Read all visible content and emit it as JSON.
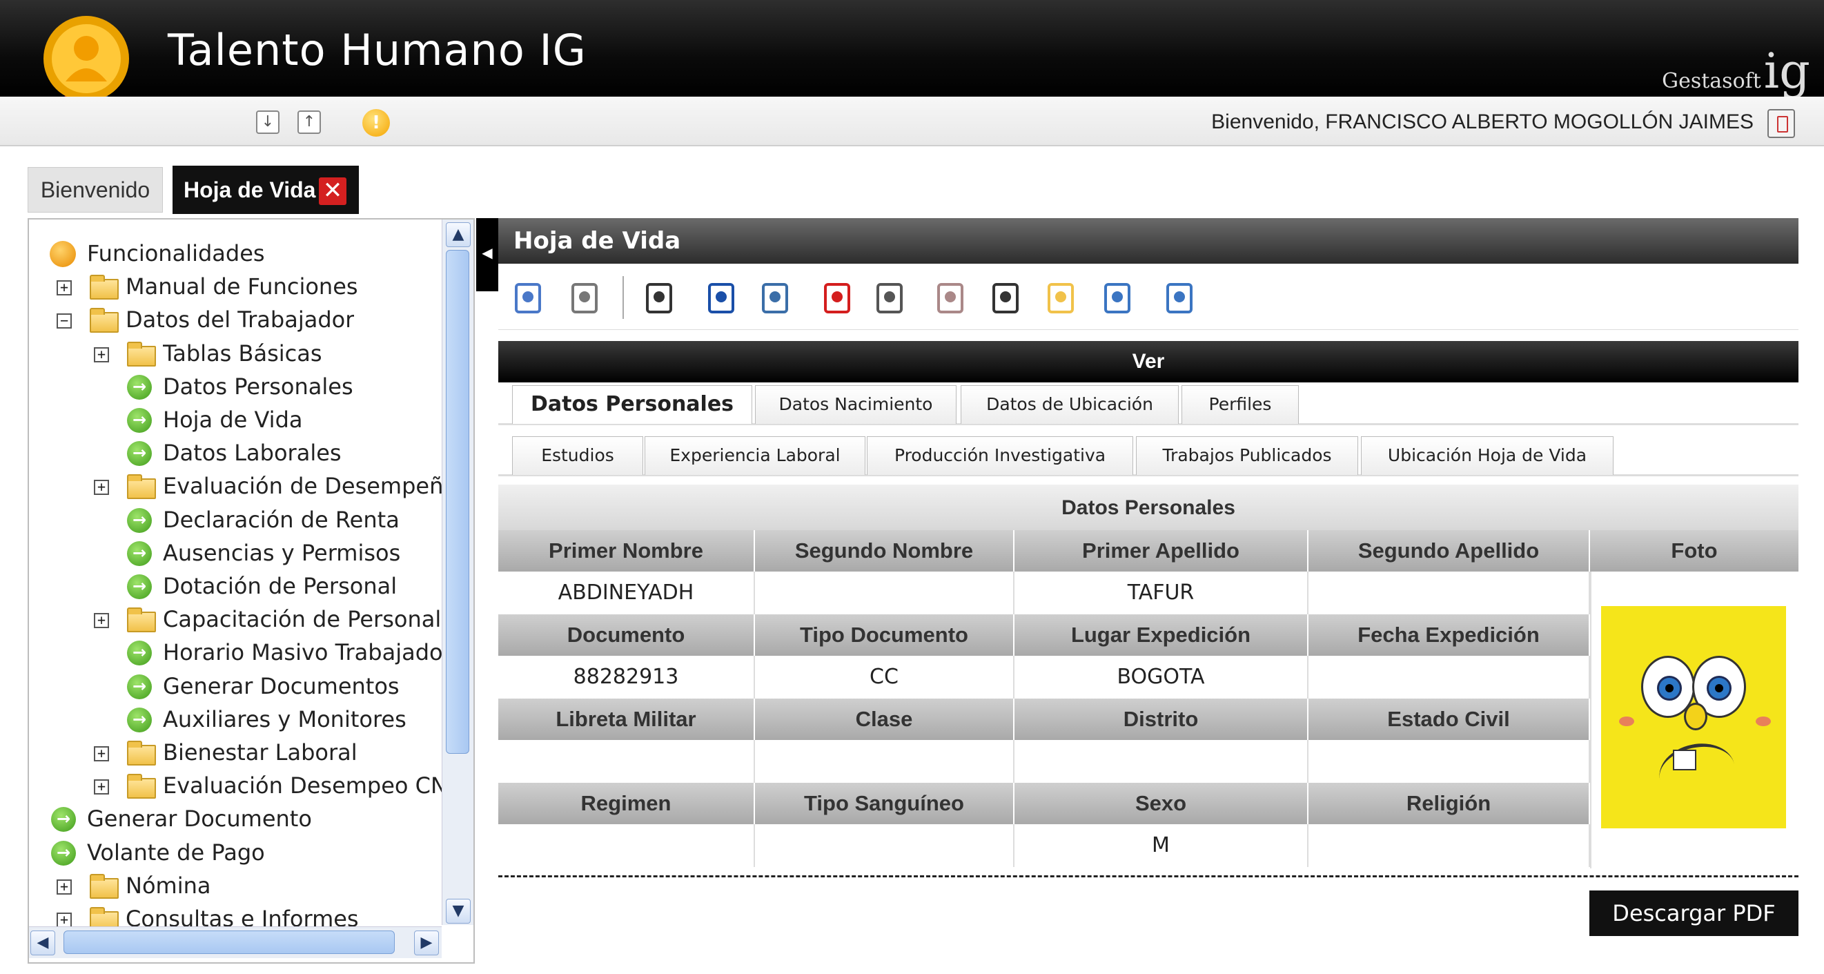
{
  "header": {
    "app_title": "Talento Humano IG",
    "brand_small": "Gestasoft",
    "brand_big": "ig",
    "welcome": "Bienvenido, FRANCISCO ALBERTO MOGOLLÓN JAIMES"
  },
  "top_tabs": [
    {
      "label": "Bienvenido",
      "active": false
    },
    {
      "label": "Hoja de Vida",
      "active": true
    }
  ],
  "tree": {
    "items": [
      {
        "label": "Funcionalidades",
        "type": "root"
      },
      {
        "label": "Manual de Funciones",
        "type": "folder",
        "state": "collapsed"
      },
      {
        "label": "Datos del Trabajador",
        "type": "folder",
        "state": "expanded"
      },
      {
        "label": "Tablas Básicas",
        "type": "folder",
        "state": "collapsed"
      },
      {
        "label": "Datos Personales",
        "type": "leaf"
      },
      {
        "label": "Hoja de Vida",
        "type": "leaf"
      },
      {
        "label": "Datos Laborales",
        "type": "leaf"
      },
      {
        "label": "Evaluación de Desempeño",
        "type": "folder",
        "state": "collapsed"
      },
      {
        "label": "Declaración de Renta",
        "type": "leaf"
      },
      {
        "label": "Ausencias y Permisos",
        "type": "leaf"
      },
      {
        "label": "Dotación de Personal",
        "type": "leaf"
      },
      {
        "label": "Capacitación de Personal",
        "type": "folder",
        "state": "collapsed"
      },
      {
        "label": "Horario Masivo Trabajador",
        "type": "leaf"
      },
      {
        "label": "Generar Documentos",
        "type": "leaf"
      },
      {
        "label": "Auxiliares y Monitores",
        "type": "leaf"
      },
      {
        "label": "Bienestar Laboral",
        "type": "folder",
        "state": "collapsed"
      },
      {
        "label": "Evaluación Desempeo CNS",
        "type": "folder",
        "state": "collapsed"
      },
      {
        "label": "Generar Documento",
        "type": "leaf"
      },
      {
        "label": "Volante de Pago",
        "type": "leaf"
      },
      {
        "label": "Nómina",
        "type": "folder",
        "state": "collapsed"
      },
      {
        "label": "Consultas e Informes",
        "type": "folder",
        "state": "collapsed"
      }
    ]
  },
  "main": {
    "title": "Hoja de Vida",
    "toolbar_icons": [
      "search-icon",
      "document-icon",
      "signature-icon",
      "id-card-icon",
      "diploma-icon",
      "award-icon",
      "graduation-icon",
      "certificate-icon",
      "desk-icon",
      "folder-icon",
      "inspect-icon",
      "inspect-alt-icon"
    ],
    "ver_label": "Ver",
    "tabs_row1": [
      {
        "label": "Datos Personales",
        "active": true
      },
      {
        "label": "Datos Nacimiento",
        "active": false
      },
      {
        "label": "Datos de Ubicación",
        "active": false
      },
      {
        "label": "Perfiles",
        "active": false
      }
    ],
    "tabs_row2": [
      {
        "label": "Estudios"
      },
      {
        "label": "Experiencia Laboral"
      },
      {
        "label": "Producción Investigativa"
      },
      {
        "label": "Trabajos Publicados"
      },
      {
        "label": "Ubicación Hoja de Vida"
      }
    ],
    "section_title": "Datos Personales",
    "photo_header": "Foto",
    "grid": [
      {
        "headers": [
          "Primer Nombre",
          "Segundo Nombre",
          "Primer Apellido",
          "Segundo Apellido"
        ],
        "values": [
          "ABDINEYADH",
          "",
          "TAFUR",
          ""
        ]
      },
      {
        "headers": [
          "Documento",
          "Tipo Documento",
          "Lugar Expedición",
          "Fecha Expedición"
        ],
        "values": [
          "88282913",
          "CC",
          "BOGOTA",
          ""
        ]
      },
      {
        "headers": [
          "Libreta Militar",
          "Clase",
          "Distrito",
          "Estado Civil"
        ],
        "values": [
          "",
          "",
          "",
          ""
        ]
      },
      {
        "headers": [
          "Regimen",
          "Tipo Sanguíneo",
          "Sexo",
          "Religión"
        ],
        "values": [
          "",
          "",
          "M",
          ""
        ]
      }
    ],
    "pdf_button": "Descargar PDF"
  },
  "colors": {
    "header_bg": "#000000",
    "accent_red": "#d42020",
    "leaf_green": "#3f9b1a",
    "folder_yellow": "#f1c24a",
    "grid_header": "#bdbdbd"
  }
}
